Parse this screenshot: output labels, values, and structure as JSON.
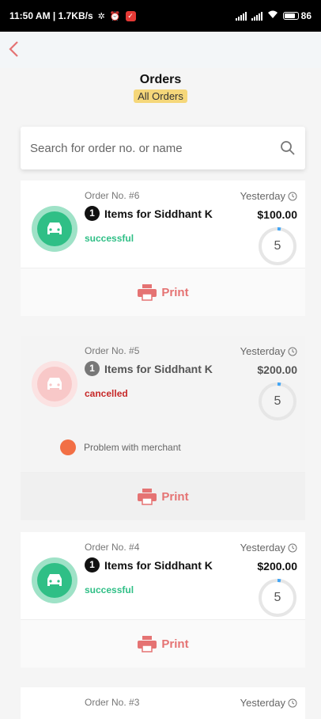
{
  "status_bar": {
    "time_speed": "11:50 AM | 1.7KB/s",
    "battery": "86"
  },
  "header": {
    "title": "Orders",
    "filter": "All Orders"
  },
  "search": {
    "placeholder": "Search for order no. or name"
  },
  "orders": [
    {
      "number": "Order No. #6",
      "date": "Yesterday",
      "quantity": "1",
      "items_label": "Items for Siddhant K",
      "price": "$100.00",
      "status": "successful",
      "progress_number": "5",
      "print_label": "Print"
    },
    {
      "number": "Order No. #5",
      "date": "Yesterday",
      "quantity": "1",
      "items_label": "Items for Siddhant K",
      "price": "$200.00",
      "status": "cancelled",
      "progress_number": "5",
      "problem": "Problem with merchant",
      "print_label": "Print"
    },
    {
      "number": "Order No. #4",
      "date": "Yesterday",
      "quantity": "1",
      "items_label": "Items for Siddhant K",
      "price": "$200.00",
      "status": "successful",
      "progress_number": "5",
      "print_label": "Print"
    },
    {
      "number": "Order No. #3",
      "date": "Yesterday"
    }
  ],
  "colors": {
    "accent": "#e57373",
    "success": "#2fbf86",
    "cancelled": "#c62828",
    "badge": "#f5d77a"
  }
}
